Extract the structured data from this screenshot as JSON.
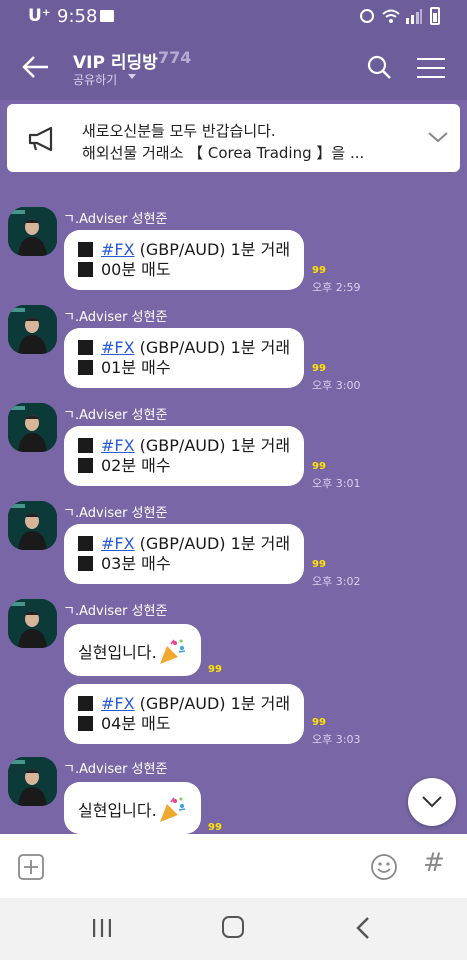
{
  "status_bar": {
    "carrier": "U⁺",
    "time": "9:58"
  },
  "header": {
    "title": "VIP 리딩방",
    "member_count": "774",
    "share_label": "공유하기"
  },
  "notice": {
    "line1": "새로오신분들 모두 반갑습니다.",
    "line2": "해외선물 거래소 【 Corea Trading 】을 ..."
  },
  "messages": [
    {
      "sender": "ㄱ.Adviser 성현준",
      "square1": "■",
      "hashtag": "#FX",
      "line1_rest": " (GBP/AUD) 1분 거래",
      "square2": "■",
      "line2_text": "00분 매도",
      "unread": "99",
      "time": "오후 2:59"
    },
    {
      "sender": "ㄱ.Adviser 성현준",
      "square1": "■",
      "hashtag": "#FX",
      "line1_rest": " (GBP/AUD) 1분 거래",
      "square2": "■",
      "line2_text": "01분 매수",
      "unread": "99",
      "time": "오후 3:00"
    },
    {
      "sender": "ㄱ.Adviser 성현준",
      "square1": "■",
      "hashtag": "#FX",
      "line1_rest": " (GBP/AUD) 1분 거래",
      "square2": "■",
      "line2_text": "02분 매수",
      "unread": "99",
      "time": "오후 3:01"
    },
    {
      "sender": "ㄱ.Adviser 성현준",
      "square1": "■",
      "hashtag": "#FX",
      "line1_rest": " (GBP/AUD) 1분 거래",
      "square2": "■",
      "line2_text": "03분 매수",
      "unread": "99",
      "time": "오후 3:02"
    },
    {
      "sender": "ㄱ.Adviser 성현준",
      "text": "실현입니다.",
      "unread": "99"
    },
    {
      "square1": "■",
      "hashtag": "#FX",
      "line1_rest": " (GBP/AUD) 1분 거래",
      "square2": "■",
      "line2_text": "04분 매도",
      "unread": "99",
      "time": "오후 3:03"
    },
    {
      "sender": "ㄱ.Adviser 성현준",
      "text": "실현입니다.",
      "unread": "99"
    }
  ],
  "input_bar": {
    "hash_label": "#"
  },
  "colors": {
    "background": "#7866a6",
    "header": "#6e5d9b",
    "unread": "#ffe300",
    "hashtag": "#2a5bd7"
  },
  "icons": [
    "back-arrow-icon",
    "search-icon",
    "menu-icon",
    "megaphone-icon",
    "chevron-down-icon",
    "party-popper-icon",
    "add-icon",
    "emoji-icon",
    "hash-icon",
    "recents-icon",
    "home-icon",
    "back-nav-icon"
  ]
}
